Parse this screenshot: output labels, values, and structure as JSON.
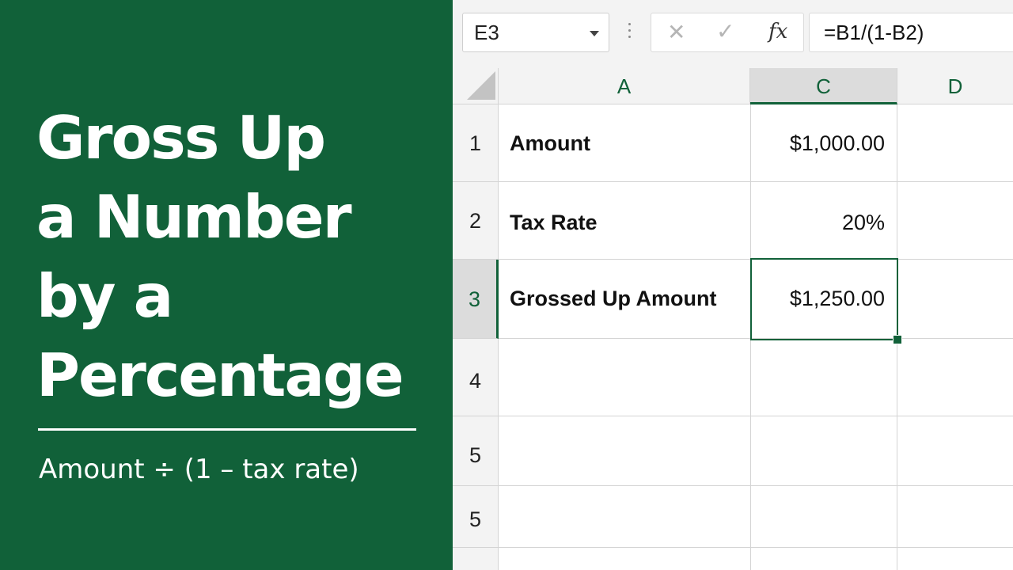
{
  "title_lines": [
    "Gross Up",
    "a Number",
    "by a",
    "Percentage"
  ],
  "subtitle": "Amount ÷ (1 – tax rate)",
  "toolbar": {
    "name_box": "E3",
    "fx_label": "fx",
    "formula": "=B1/(1-B2)",
    "icons": {
      "cancel": "cancel-x-icon",
      "enter": "enter-check-icon",
      "dropdown": "chevron-down-icon"
    }
  },
  "columns": [
    "A",
    "C",
    "D"
  ],
  "rows": [
    "1",
    "2",
    "3",
    "4",
    "5",
    "5"
  ],
  "cells": [
    {
      "label": "Amount",
      "value": "$1,000.00"
    },
    {
      "label": "Tax Rate",
      "value": "20%"
    },
    {
      "label": "Grossed Up Amount",
      "value": "$1,250.00"
    }
  ],
  "colors": {
    "brand_green": "#116139",
    "header_gray": "#f3f3f3",
    "grid": "#d4d4d4"
  }
}
